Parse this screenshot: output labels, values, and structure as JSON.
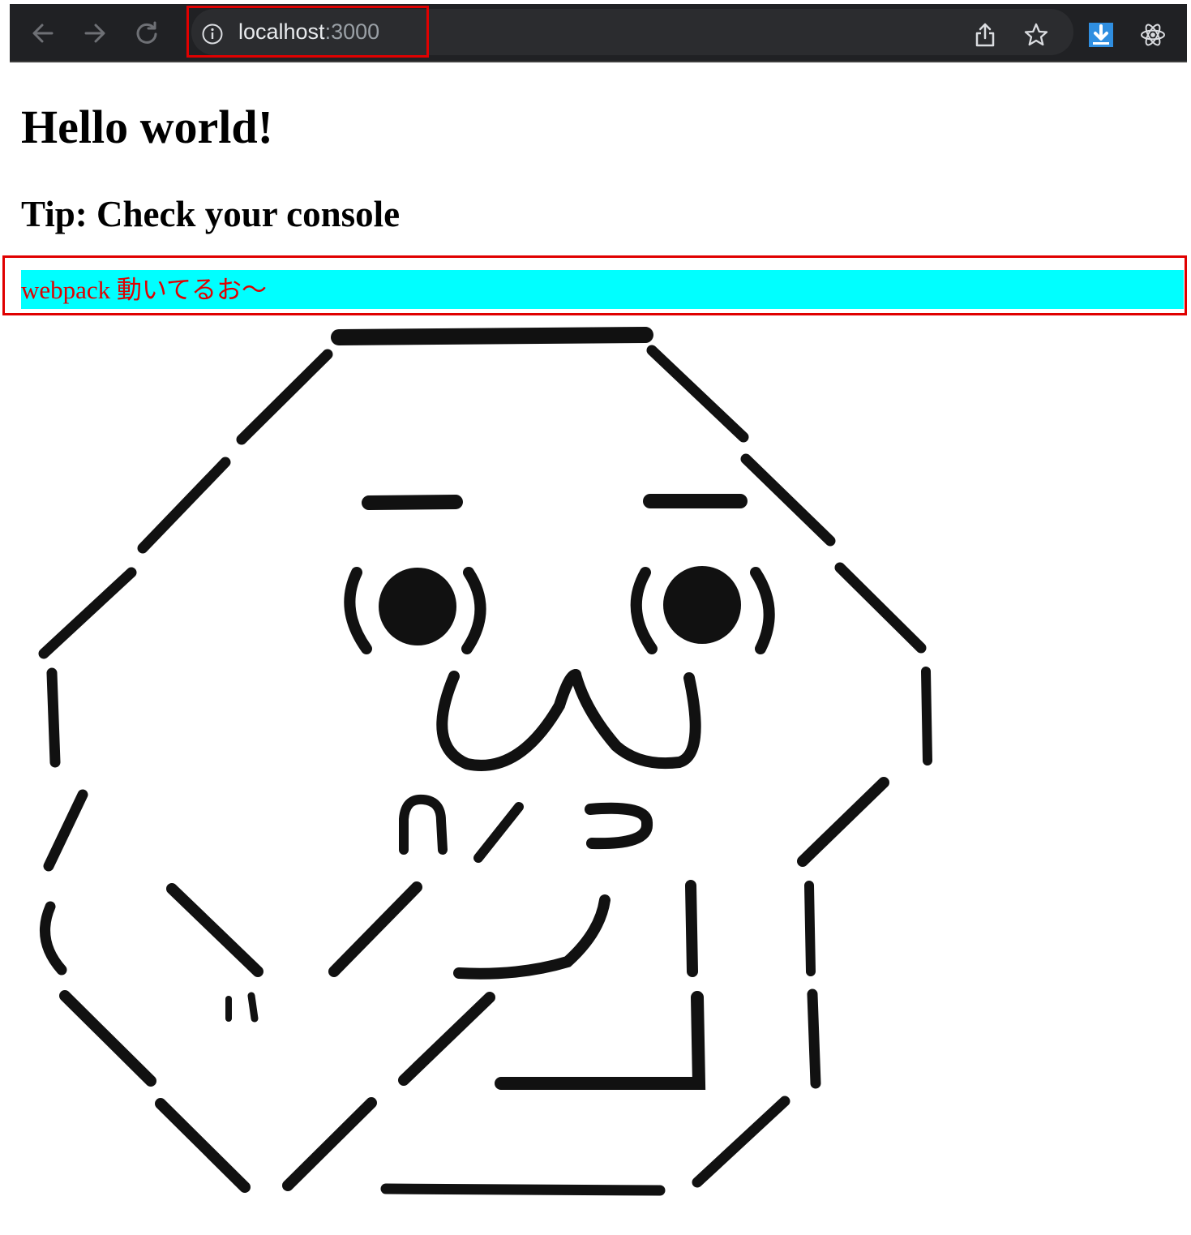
{
  "browser": {
    "url_host": "localhost",
    "url_port": ":3000",
    "icons": {
      "back": "arrow-left-icon",
      "forward": "arrow-right-icon",
      "reload": "reload-icon",
      "site_info": "info-icon",
      "share": "share-icon",
      "bookmark": "star-icon",
      "download_extension": "download-icon",
      "react_devtools": "react-icon"
    },
    "colors": {
      "toolbar": "#202124",
      "omnibox": "#2b2c2f",
      "highlight": "#e00000"
    }
  },
  "page": {
    "title": "Hello world!",
    "tip": "Tip: Check your console",
    "status_text": "webpack 動いてるお〜",
    "colors": {
      "status_background": "#00ffff",
      "status_text": "#e00000"
    }
  }
}
